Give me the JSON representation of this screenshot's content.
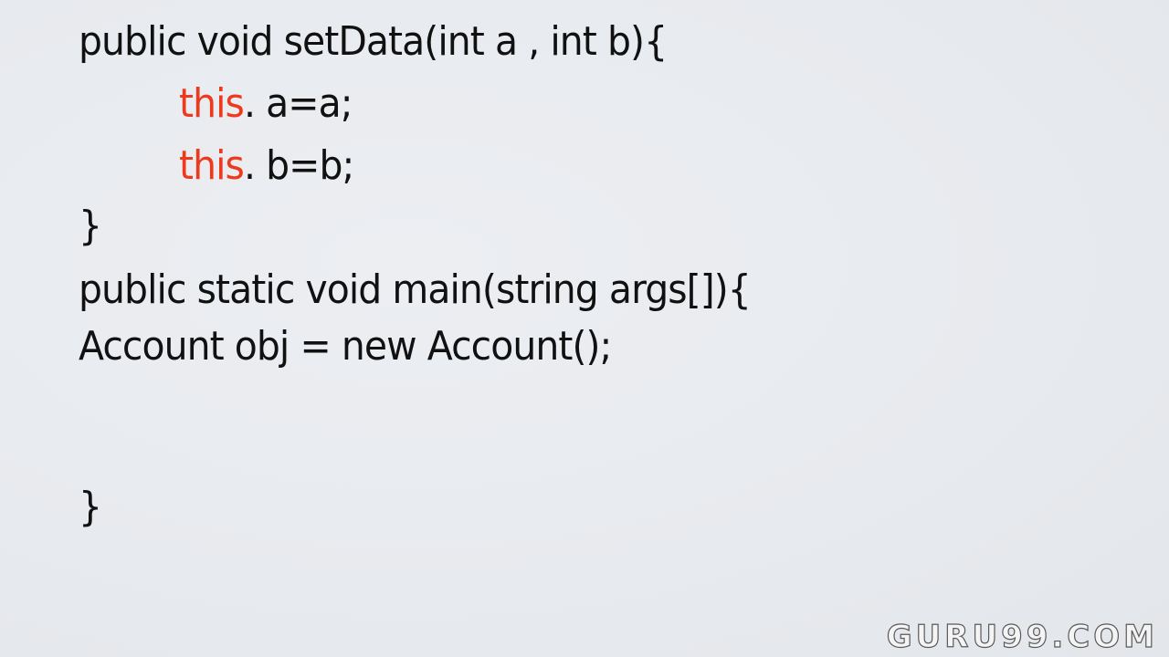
{
  "code": {
    "line1": "public void setData(int a , int b){",
    "line2_keyword": "this",
    "line2_rest": ". a=a;",
    "line3_keyword": "this",
    "line3_rest": ". b=b;",
    "line4": "}",
    "line5": "public static void main(string args[]){",
    "line6": "Account obj = new Account();",
    "line7": "}"
  },
  "watermark": "GURU99.COM",
  "colors": {
    "background": "#e8ebef",
    "text": "#111111",
    "keyword_this": "#ee3a1c"
  }
}
